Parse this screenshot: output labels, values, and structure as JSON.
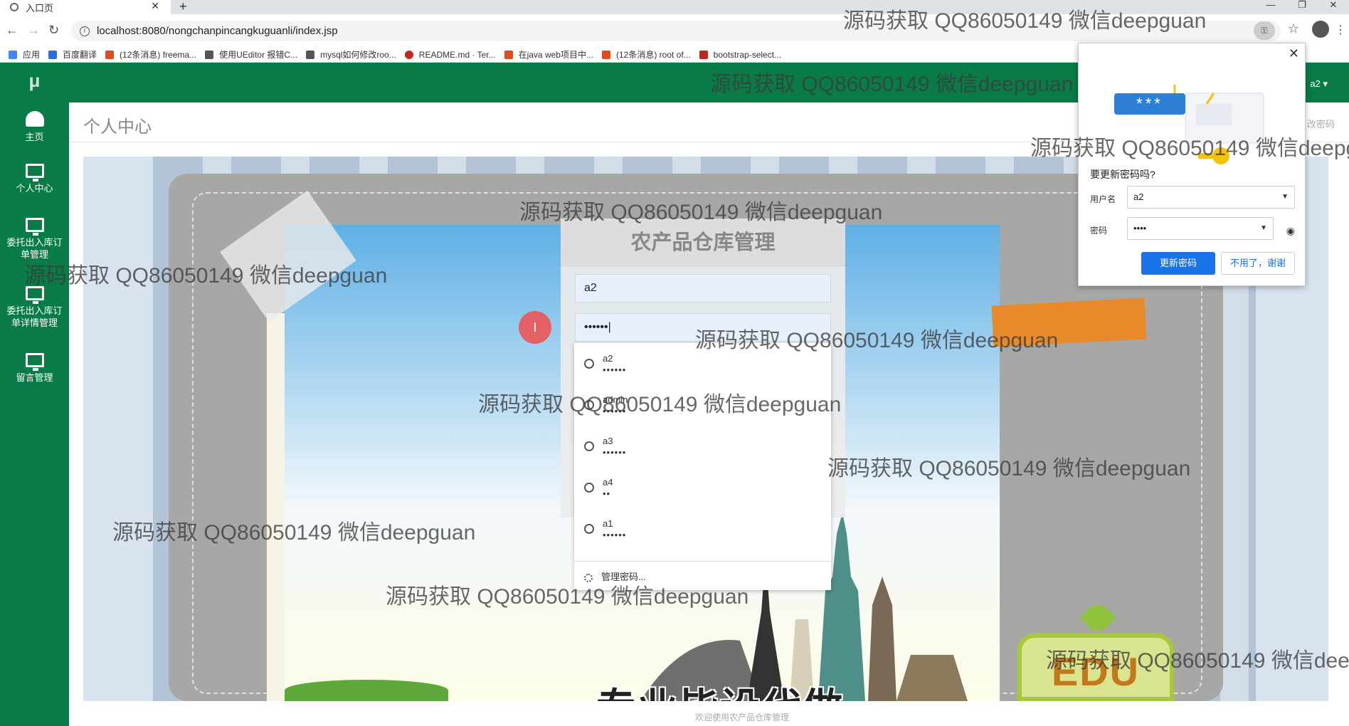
{
  "browser": {
    "tab_title": "入口页",
    "url": "localhost:8080/nongchanpincangkuguanli/index.jsp",
    "bookmarks": [
      {
        "label": "应用",
        "color": "#4285f4"
      },
      {
        "label": "百度翻译",
        "color": "#2f6be0"
      },
      {
        "label": "(12条消息) freema...",
        "color": "#e04b1f"
      },
      {
        "label": "使用UEditor 报错C...",
        "color": "#555555"
      },
      {
        "label": "mysql如何修改roo...",
        "color": "#555555"
      },
      {
        "label": "README.md · Ter...",
        "color": "#c2261c"
      },
      {
        "label": "在java web项目中...",
        "color": "#e04b1f"
      },
      {
        "label": "(12条消息) root of...",
        "color": "#e04b1f"
      },
      {
        "label": "bootstrap-select...",
        "color": "#c2261c"
      }
    ]
  },
  "app": {
    "logo": "μ",
    "user_menu": "a2 ▾",
    "page_title": "个人中心",
    "change_password_link": "改密码",
    "footer_text": "欢迎使用农产品仓库管理",
    "promo_text": "专业毕设代做",
    "edu_text": "EDU",
    "sidebar": [
      {
        "label": "主页",
        "icon": "dashboard-icon"
      },
      {
        "label": "个人中心",
        "icon": "monitor-icon"
      },
      {
        "label": "委托出入库订单管理",
        "icon": "monitor-icon"
      },
      {
        "label": "委托出入库订单详情管理",
        "icon": "monitor-icon"
      },
      {
        "label": "留言管理",
        "icon": "monitor-icon"
      }
    ]
  },
  "login": {
    "title": "农产品仓库管理",
    "username_value": "a2",
    "password_value": "••••••|",
    "cursor_glyph": "I"
  },
  "autocomplete": {
    "items": [
      {
        "user": "a2",
        "pass": "••••••"
      },
      {
        "user": "admin",
        "pass": "••••••"
      },
      {
        "user": "a3",
        "pass": "••••••"
      },
      {
        "user": "a4",
        "pass": "••"
      },
      {
        "user": "a1",
        "pass": "••••••"
      }
    ],
    "manage_label": "管理密码..."
  },
  "password_popup": {
    "heading": "要更新密码吗?",
    "username_label": "用户名",
    "username_value": "a2",
    "password_label": "密码",
    "password_value": "••••",
    "pass_pill": "***",
    "update_button": "更新密码",
    "no_thanks_button": "不用了，谢谢"
  },
  "watermark": "源码获取 QQ86050149 微信deepguan",
  "colors": {
    "sidebar": "#087b46",
    "accent_blue": "#1a73e8",
    "cursor_marker": "#e36064"
  }
}
